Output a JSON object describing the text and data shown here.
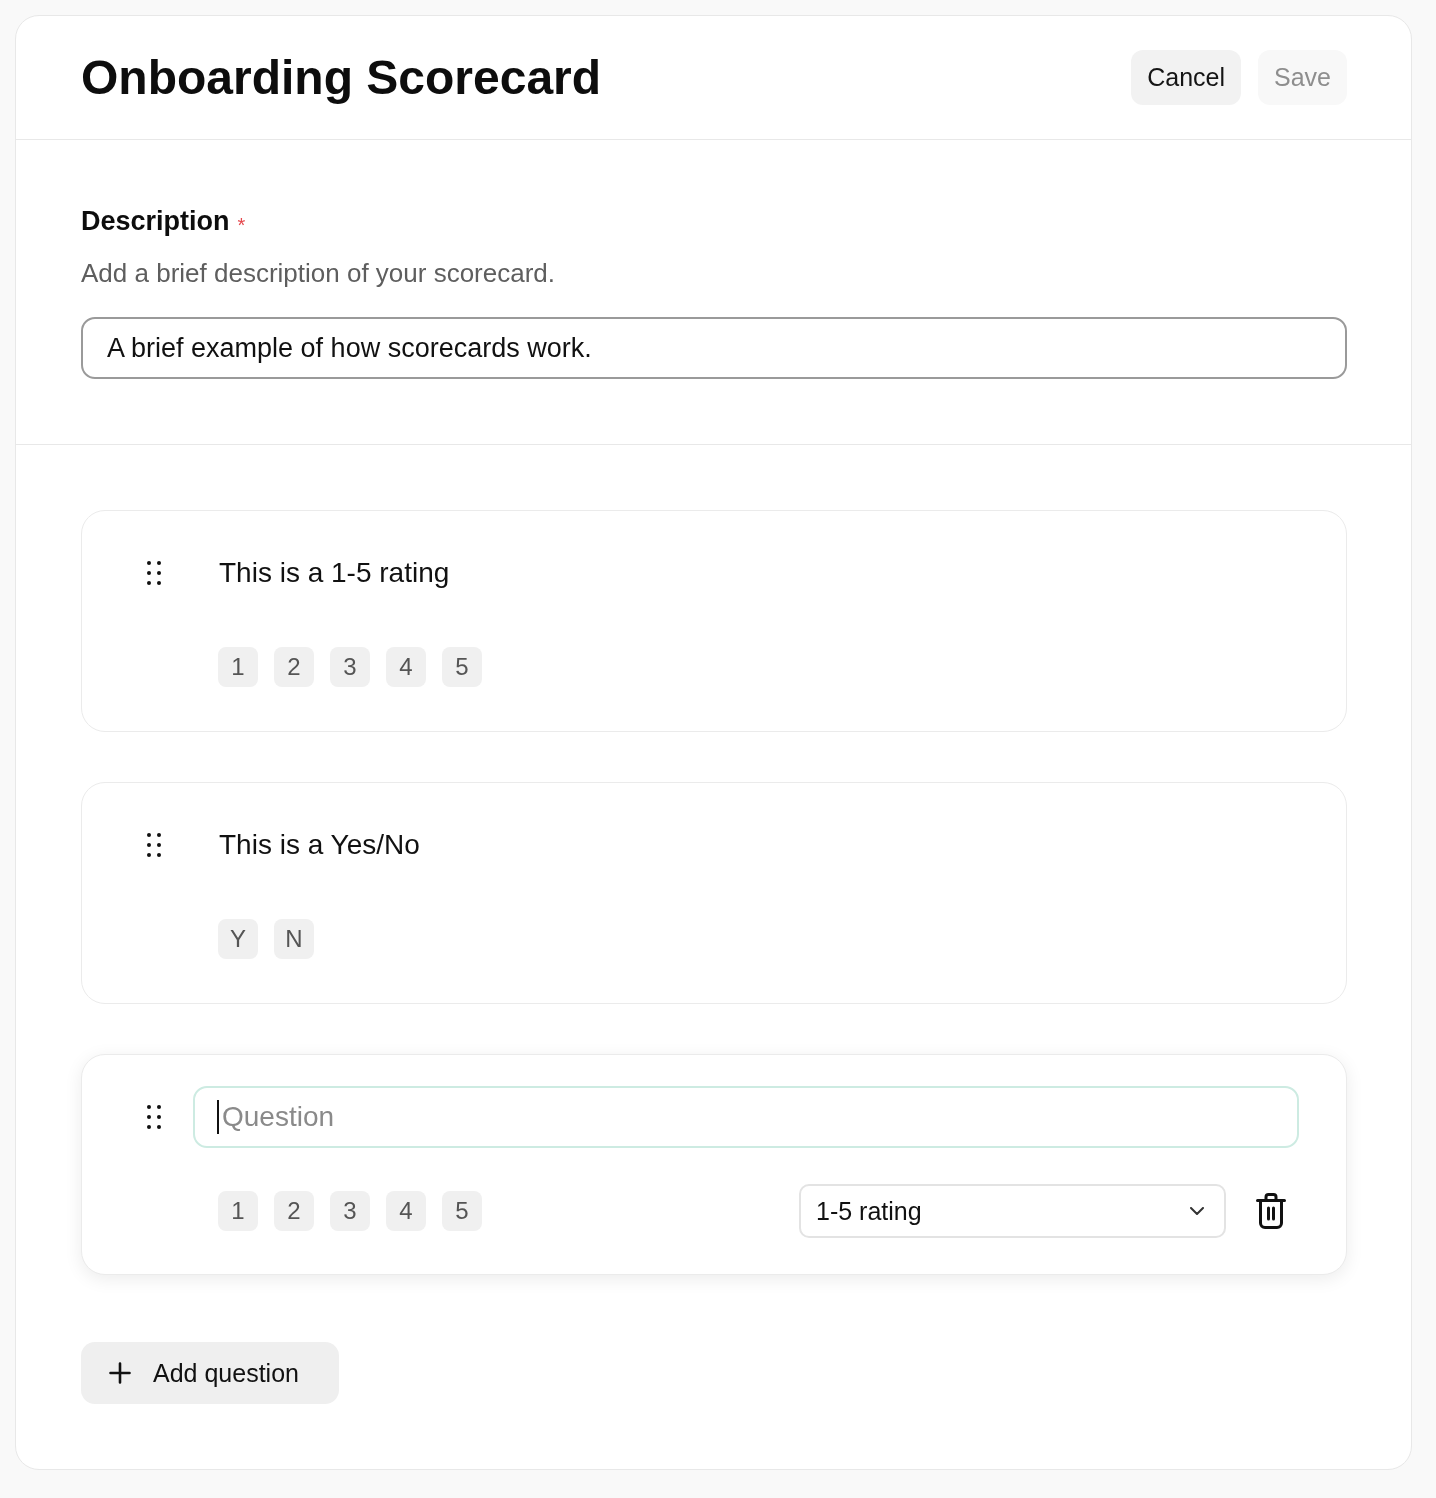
{
  "header": {
    "title": "Onboarding Scorecard",
    "buttons": [
      {
        "label": "Cancel",
        "disabled": false
      },
      {
        "label": "Save",
        "disabled": true
      }
    ]
  },
  "description": {
    "label": "Description",
    "required_mark": "*",
    "help": "Add a brief description of your scorecard.",
    "value": "A brief example of how scorecards work."
  },
  "questions": [
    {
      "editing": false,
      "text": "This is a 1-5 rating",
      "options": [
        "1",
        "2",
        "3",
        "4",
        "5"
      ]
    },
    {
      "editing": false,
      "text": "This is a Yes/No",
      "options": [
        "Y",
        "N"
      ]
    },
    {
      "editing": true,
      "focused": true,
      "placeholder": "Question",
      "options": [
        "1",
        "2",
        "3",
        "4",
        "5"
      ],
      "type_select": "1-5 rating"
    }
  ],
  "add_button": {
    "label": "Add question"
  }
}
